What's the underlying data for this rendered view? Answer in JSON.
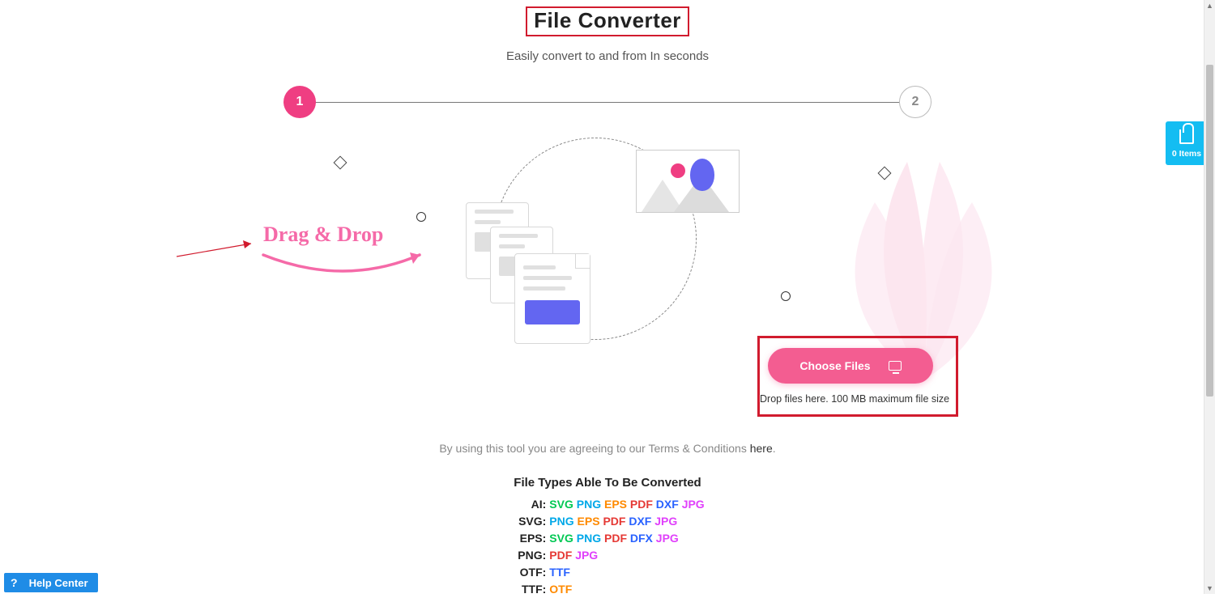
{
  "header": {
    "title": "File Converter",
    "subtitle": "Easily convert to and from In seconds"
  },
  "stepper": {
    "step1_label": "1",
    "step2_label": "2"
  },
  "drop": {
    "drag_label": "Drag & Drop",
    "choose_btn_label": "Choose Files",
    "hint_text": "Drop files here. 100 MB maximum file size"
  },
  "terms": {
    "prefix": "By using this tool you are agreeing to our Terms & Conditions ",
    "link_label": "here",
    "suffix": "."
  },
  "formats": {
    "title": "File Types Able To Be Converted",
    "rows": [
      {
        "src": "AI:",
        "targets": [
          "SVG",
          "PNG",
          "EPS",
          "PDF",
          "DXF",
          "JPG"
        ]
      },
      {
        "src": "SVG:",
        "targets": [
          "PNG",
          "EPS",
          "PDF",
          "DXF",
          "JPG"
        ]
      },
      {
        "src": "EPS:",
        "targets": [
          "SVG",
          "PNG",
          "PDF",
          "DFX",
          "JPG"
        ]
      },
      {
        "src": "PNG:",
        "targets": [
          "PDF",
          "JPG"
        ]
      },
      {
        "src": "OTF:",
        "targets": [
          "TTF"
        ]
      },
      {
        "src": "TTF:",
        "targets": [
          "OTF"
        ]
      }
    ]
  },
  "help": {
    "label": "Help Center"
  },
  "cart": {
    "count_label": "0 Items"
  },
  "colors": {
    "accent_pink": "#ef3e82",
    "accent_blue": "#14bdf2",
    "annotation_red": "#d11b2e",
    "indigo": "#6366f1",
    "help_blue": "#1f8ce6"
  }
}
